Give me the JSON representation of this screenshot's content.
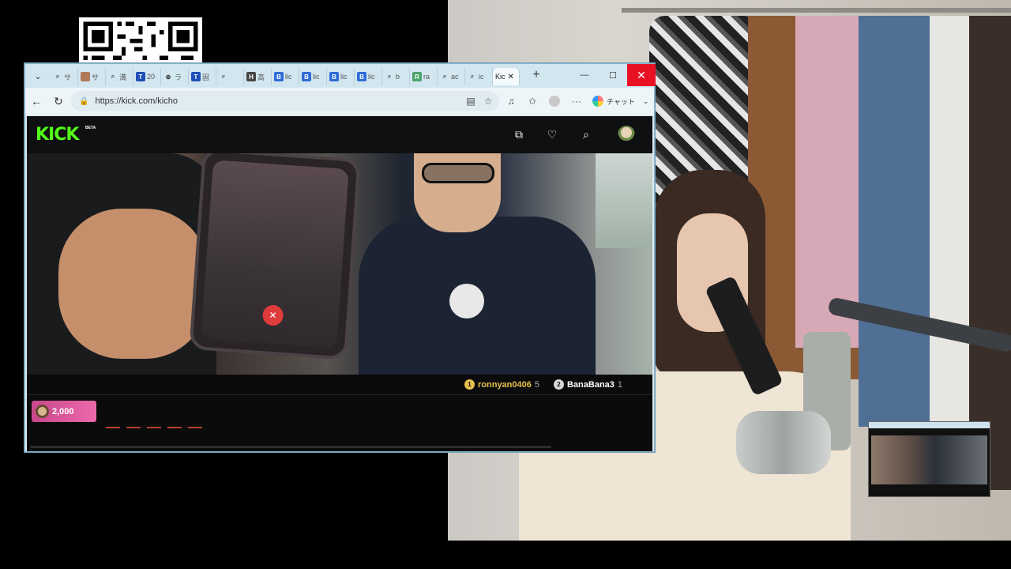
{
  "browser": {
    "tabs": [
      {
        "icon": "search-icon",
        "text": "サ"
      },
      {
        "icon": "avatar-icon",
        "text": "サ"
      },
      {
        "icon": "search-icon",
        "text": "満"
      },
      {
        "icon": "t-icon",
        "text": "20"
      },
      {
        "icon": "globe-icon",
        "text": "ラ"
      },
      {
        "icon": "t-icon",
        "text": "固"
      },
      {
        "icon": "search-icon",
        "text": ""
      },
      {
        "icon": "h-icon",
        "text": "高"
      },
      {
        "icon": "b-icon",
        "text": "lic"
      },
      {
        "icon": "b-icon",
        "text": "lic"
      },
      {
        "icon": "b-icon",
        "text": "lic"
      },
      {
        "icon": "b-icon",
        "text": "lic"
      },
      {
        "icon": "search-icon",
        "text": "b"
      },
      {
        "icon": "r-icon",
        "text": "ra"
      },
      {
        "icon": "search-icon",
        "text": "ac"
      },
      {
        "icon": "search-icon",
        "text": "ic"
      }
    ],
    "active_tab": {
      "text": "Kic"
    },
    "url": "https://kick.com/kicho",
    "copilot_label": "チャット",
    "colors": {
      "accent_close": "#e81123",
      "tabbar": "#d2e6f0"
    }
  },
  "kick": {
    "logo": "KICK",
    "beta": "BETA",
    "brand_color": "#53fc18",
    "leaderboard": [
      {
        "rank": "1",
        "name": "ronnyan0406",
        "count": "5"
      },
      {
        "rank": "2",
        "name": "BanaBana3",
        "count": "1"
      }
    ],
    "gift_amount": "2,000"
  }
}
